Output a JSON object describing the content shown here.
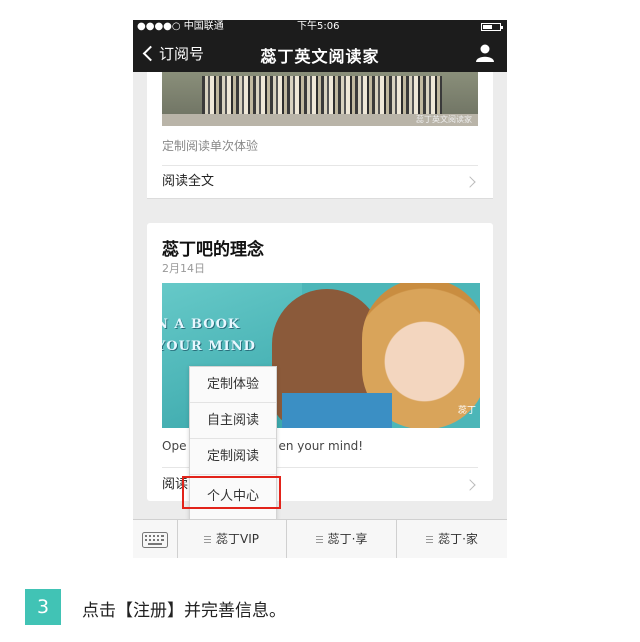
{
  "status_bar": {
    "carrier": "●●●●○ 中国联通 ",
    "time": "下午5:06"
  },
  "nav": {
    "back_label": "订阅号",
    "title": "蕊丁英文阅读家"
  },
  "article1": {
    "image_watermark": "蕊丁英文阅读家",
    "subtitle": "定制阅读单次体验",
    "read_full_label": "阅读全文"
  },
  "article2": {
    "title": "蕊丁吧的理念",
    "date": "2月14日",
    "cover_text_1": "N A BOOK",
    "cover_text_2": "YOUR MIND",
    "cover_watermark": "蕊丁",
    "excerpt_left": "Ope",
    "excerpt_right": "en your mind!",
    "read_more_label": "阅读"
  },
  "popup_menu": {
    "items": [
      {
        "label": "定制体验"
      },
      {
        "label": "自主阅读"
      },
      {
        "label": "定制阅读"
      },
      {
        "label": "个人中心"
      }
    ],
    "highlight_color": "#e2231a"
  },
  "tab_bar": {
    "tabs": [
      {
        "label": "蕊丁VIP"
      },
      {
        "label": "蕊丁·享"
      },
      {
        "label": "蕊丁·家"
      }
    ]
  },
  "step": {
    "number": "3",
    "instruction": "点击【注册】并完善信息。",
    "badge_color": "#41c3b5"
  }
}
